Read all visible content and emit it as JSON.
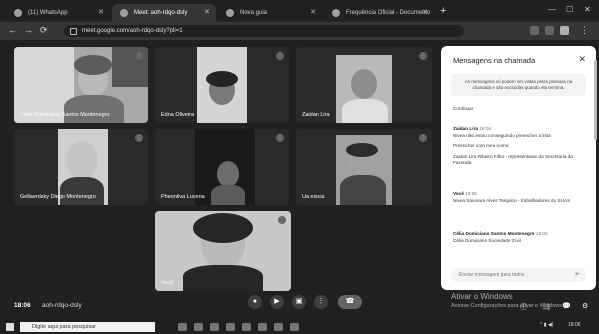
{
  "browser": {
    "tabs": [
      {
        "label": "(11) WhatsApp",
        "active": false
      },
      {
        "label": "Meet: aoh-rdqo-dsly",
        "active": true
      },
      {
        "label": "Nova guia",
        "active": false
      },
      {
        "label": "Frequência Oficial - Documento",
        "active": false
      }
    ],
    "new_tab": "+",
    "url": "meet.google.com/aoh-rdqo-dsly?pli=1"
  },
  "meeting": {
    "participants": [
      {
        "name": "Célia Domiciano Santos Montenegro"
      },
      {
        "name": "Edna Oliveira"
      },
      {
        "name": "Zaidan Lira"
      },
      {
        "name": "Gellaerdsky Diego Montenegro"
      },
      {
        "name": "Pheonilva Lucena"
      },
      {
        "name": "Ua eiscia"
      },
      {
        "name": "Você"
      }
    ],
    "time": "18:06",
    "code": "aoh-rdqo-dsly",
    "controls": [
      "mic-button",
      "camera-button",
      "present-button",
      "more-button",
      "leave-button"
    ]
  },
  "chat": {
    "title": "Mensagens na chamada",
    "info": "As mensagens só podem ser vistas pelas pessoas na chamada e são excluídas quando ela termina.",
    "first": "Continuar",
    "messages": [
      {
        "who": "Zaidan Lira",
        "time": "18:06",
        "lines": [
          "Nivea não estou conseguindo preencher a lista",
          "Preencher com meu nome:",
          "Zaidan Lira Ribeiro Filho - representante da Secretaria da Fazenda"
        ]
      },
      {
        "who": "Você",
        "time": "18:06",
        "lines": [
          "Nivea Saionara Alves Tarquino - trabalhadores do SUAS"
        ]
      },
      {
        "who": "Célia Domiciano Santos Montenegro",
        "time": "18:06",
        "lines": [
          "Célia Domiciano Sociedade Civil"
        ]
      }
    ],
    "input_placeholder": "Enviar mensagem para todos"
  },
  "watermark": {
    "line1": "Ativar o Windows",
    "line2": "Acesse Configurações para ativar o Windows."
  },
  "taskbar": {
    "search_placeholder": "Digite aqui para pesquisar",
    "clock": "18:06"
  }
}
